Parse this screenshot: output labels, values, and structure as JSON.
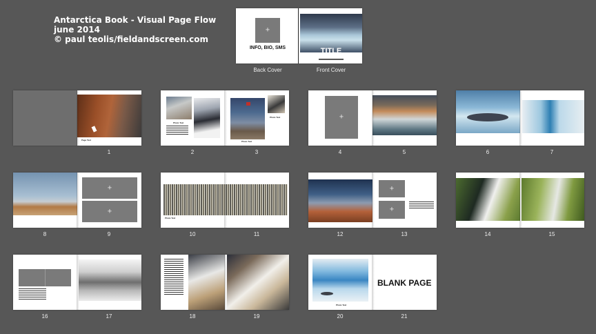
{
  "header": {
    "line1": "Antarctica Book - Visual Page Flow",
    "line2": "june 2014",
    "line3": "© paul teolis/fieldandscreen.com"
  },
  "cover": {
    "back_label": "Back Cover",
    "front_label": "Front Cover",
    "back_text": "INFO, BIO, SMS",
    "front_title": "TITLE",
    "placeholder": "+"
  },
  "pages": {
    "p1": "1",
    "p2": "2",
    "p3": "3",
    "p4": "4",
    "p5": "5",
    "p6": "6",
    "p7": "7",
    "p8": "8",
    "p9": "9",
    "p10": "10",
    "p11": "11",
    "p12": "12",
    "p13": "13",
    "p14": "14",
    "p15": "15",
    "p16": "16",
    "p17": "17",
    "p18": "18",
    "p19": "19",
    "p20": "20",
    "p21": "21"
  },
  "captions": {
    "photo_text": "Photo Text",
    "page_text": "Page Text"
  },
  "blank_page": "BLANK PAGE"
}
